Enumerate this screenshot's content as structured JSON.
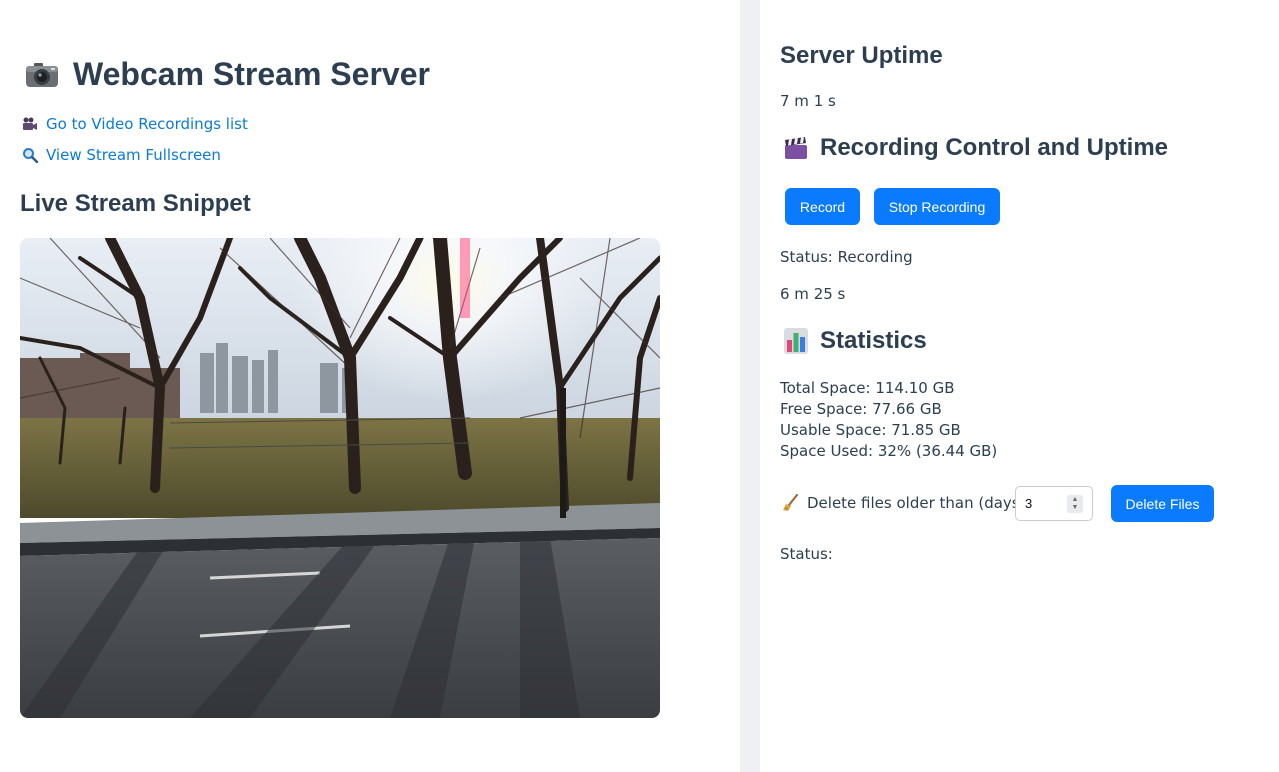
{
  "header": {
    "title": "Webcam Stream Server",
    "title_icon": "camera-icon"
  },
  "links": {
    "recordings": {
      "label": "Go to Video Recordings list",
      "icon": "video-camera-icon"
    },
    "fullscreen": {
      "label": "View Stream Fullscreen",
      "icon": "magnifier-icon"
    }
  },
  "live": {
    "heading": "Live Stream Snippet"
  },
  "server": {
    "heading": "Server Uptime",
    "uptime": "7 m 1 s"
  },
  "recording": {
    "heading": "Recording Control and Uptime",
    "heading_icon": "clapperboard-icon",
    "record_label": "Record",
    "stop_label": "Stop Recording",
    "status": "Status: Recording",
    "uptime": "6 m 25 s"
  },
  "statistics": {
    "heading": "Statistics",
    "heading_icon": "bar-chart-icon",
    "total": "Total Space: 114.10 GB",
    "free": "Free Space: 77.66 GB",
    "usable": "Usable Space: 71.85 GB",
    "used": "Space Used: 32% (36.44 GB)"
  },
  "cleanup": {
    "label": "Delete files older than (days):",
    "icon": "broom-icon",
    "days_value": "3",
    "delete_label": "Delete Files",
    "status": "Status:"
  },
  "colors": {
    "accent": "#0a7bff",
    "link": "#0a7bd6",
    "heading": "#2c3e50",
    "background": "#eef0f3"
  }
}
